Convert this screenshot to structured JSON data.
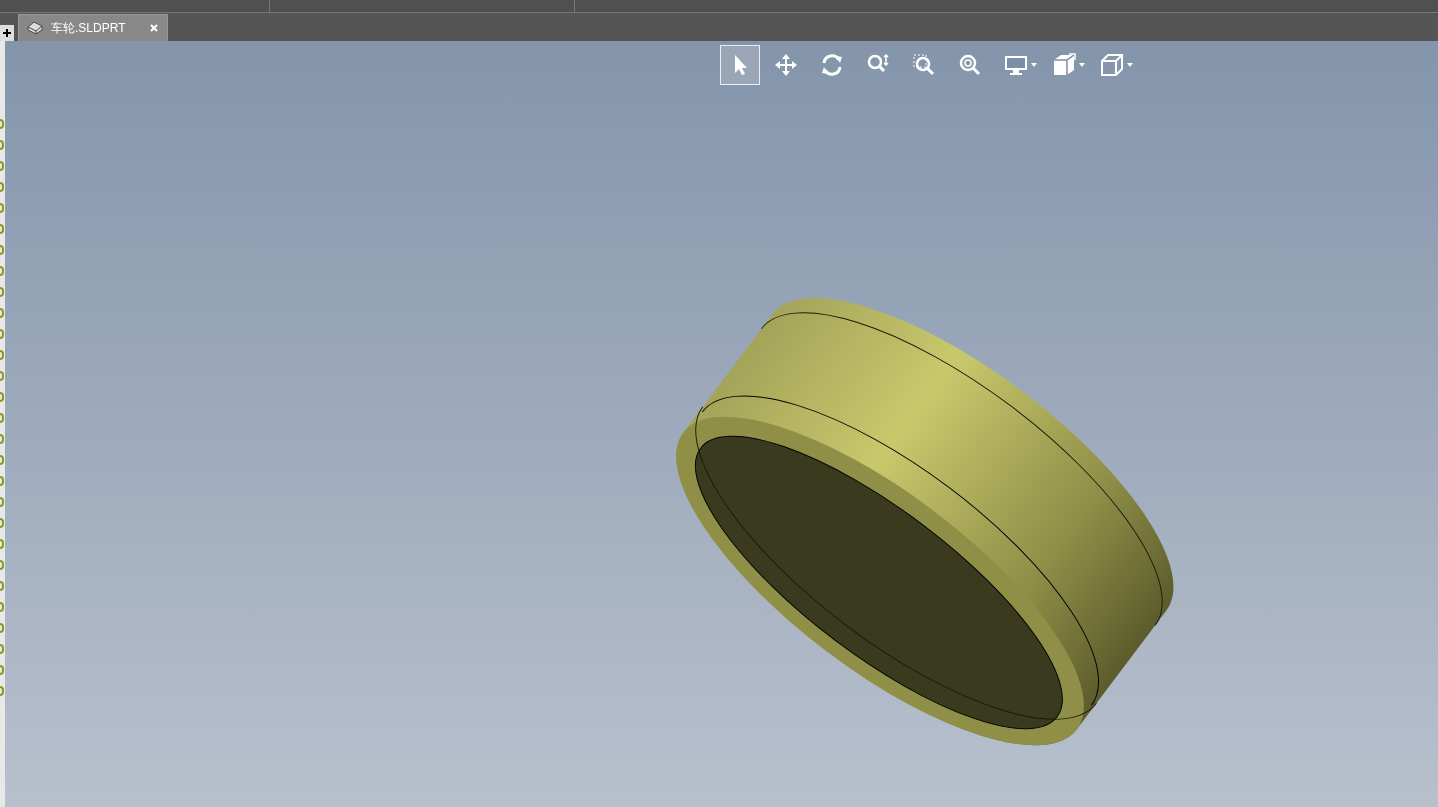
{
  "document_tabs": [
    {
      "label": "车轮.SLDPRT",
      "selected": true
    }
  ],
  "view_toolbar": [
    {
      "kind": "select",
      "selected": true,
      "dropdown": false
    },
    {
      "kind": "pan",
      "selected": false,
      "dropdown": false
    },
    {
      "kind": "rotate",
      "selected": false,
      "dropdown": false
    },
    {
      "kind": "zoom",
      "selected": false,
      "dropdown": false
    },
    {
      "kind": "zoom_area",
      "selected": false,
      "dropdown": false
    },
    {
      "kind": "zoom_fit",
      "selected": false,
      "dropdown": false
    },
    {
      "kind": "display",
      "selected": false,
      "dropdown": true
    },
    {
      "kind": "section",
      "selected": false,
      "dropdown": true
    },
    {
      "kind": "view_cube",
      "selected": false,
      "dropdown": true
    }
  ]
}
